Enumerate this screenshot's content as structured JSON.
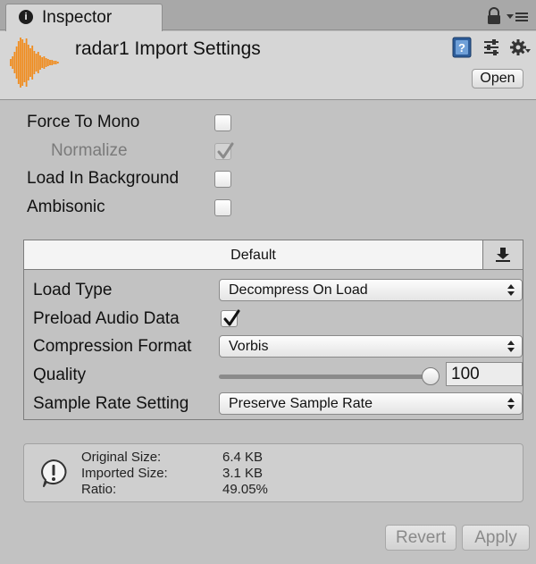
{
  "tab": {
    "title": "Inspector",
    "icon": "info-icon"
  },
  "header": {
    "title": "radar1 Import Settings",
    "open_label": "Open",
    "icons": [
      "audio-waveform-icon",
      "help-icon",
      "preset-icon",
      "gear-icon"
    ]
  },
  "options": {
    "force_to_mono": {
      "label": "Force To Mono",
      "checked": false
    },
    "normalize": {
      "label": "Normalize",
      "checked": true,
      "disabled": true
    },
    "load_in_background": {
      "label": "Load In Background",
      "checked": false
    },
    "ambisonic": {
      "label": "Ambisonic",
      "checked": false
    }
  },
  "platform": {
    "tab_label": "Default",
    "load_type": {
      "label": "Load Type",
      "value": "Decompress On Load"
    },
    "preload_audio_data": {
      "label": "Preload Audio Data",
      "checked": true
    },
    "compression_format": {
      "label": "Compression Format",
      "value": "Vorbis"
    },
    "quality": {
      "label": "Quality",
      "value": "100",
      "slider_fraction": 1.0
    },
    "sample_rate_setting": {
      "label": "Sample Rate Setting",
      "value": "Preserve Sample Rate"
    }
  },
  "info": {
    "icon": "warning-speech-icon",
    "rows": [
      {
        "label": "Original Size:",
        "value": "6.4 KB"
      },
      {
        "label": "Imported Size:",
        "value": "3.1 KB"
      },
      {
        "label": "Ratio:",
        "value": "49.05%"
      }
    ]
  },
  "buttons": {
    "revert": "Revert",
    "apply": "Apply"
  },
  "colors": {
    "waveform": "#f08c1e",
    "panel_bg": "#c2c2c2",
    "header_bg": "#d6d6d6"
  }
}
